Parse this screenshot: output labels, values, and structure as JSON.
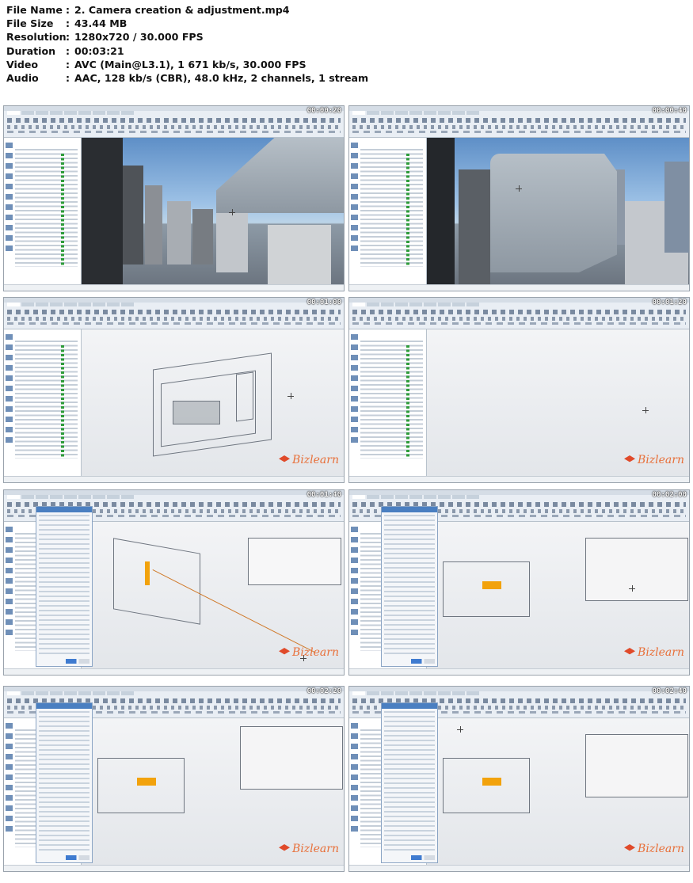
{
  "media_info": [
    {
      "key": "File Name",
      "value": "2. Camera creation & adjustment.mp4"
    },
    {
      "key": "File Size",
      "value": "43.44 MB"
    },
    {
      "key": "Resolution",
      "value": "1280x720 / 30.000 FPS"
    },
    {
      "key": "Duration",
      "value": "00:03:21"
    },
    {
      "key": "Video",
      "value": "AVC (Main@L3.1), 1 671 kb/s, 30.000 FPS"
    },
    {
      "key": "Audio",
      "value": "AAC, 128 kb/s (CBR), 48.0 kHz, 2 channels, 1 stream"
    }
  ],
  "separator": ":",
  "thumbnails": [
    {
      "timestamp": "00:00:20",
      "scene": "city"
    },
    {
      "timestamp": "00:00:40",
      "scene": "city-zoom"
    },
    {
      "timestamp": "00:01:00",
      "scene": "wireframe"
    },
    {
      "timestamp": "00:01:20",
      "scene": "empty"
    },
    {
      "timestamp": "00:01:40",
      "scene": "camera-dialog"
    },
    {
      "timestamp": "00:02:00",
      "scene": "camera-dialog"
    },
    {
      "timestamp": "00:02:20",
      "scene": "camera-dialog"
    },
    {
      "timestamp": "00:02:40",
      "scene": "camera-dialog"
    }
  ],
  "brand": {
    "name": "Bizlearn",
    "color": "#e8703a"
  },
  "colors": {
    "accent": "#4a7fc1",
    "check": "#2e9c3a",
    "highlight": "#f2a20c"
  }
}
